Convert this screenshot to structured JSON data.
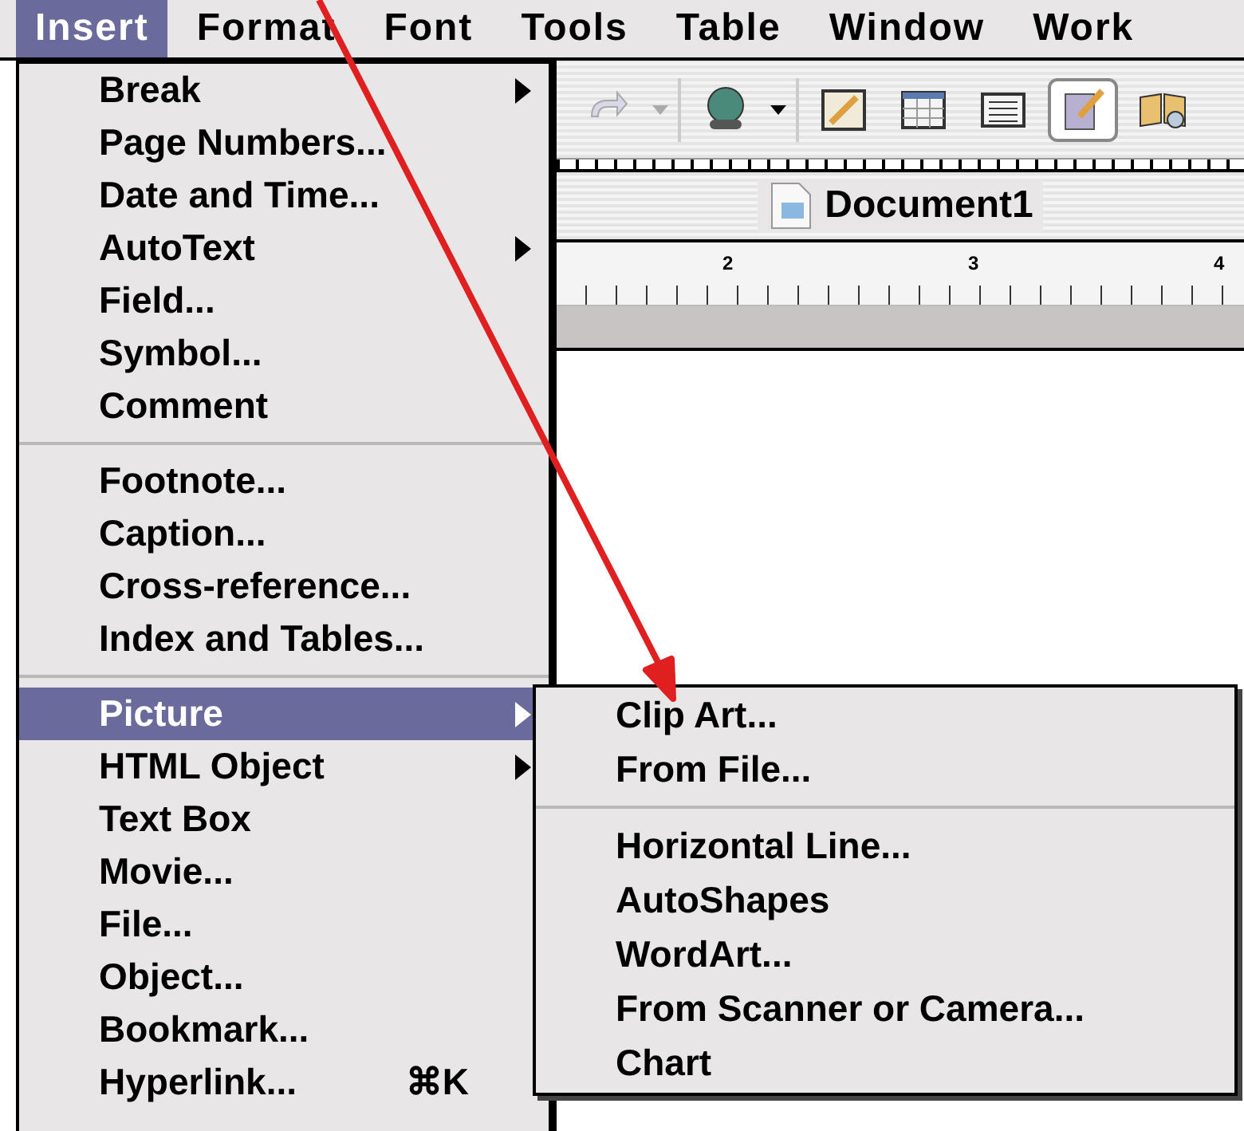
{
  "menu_bar": [
    {
      "label": "Insert",
      "selected": true
    },
    {
      "label": "Format",
      "selected": false
    },
    {
      "label": "Font",
      "selected": false
    },
    {
      "label": "Tools",
      "selected": false
    },
    {
      "label": "Table",
      "selected": false
    },
    {
      "label": "Window",
      "selected": false
    },
    {
      "label": "Work",
      "selected": false
    }
  ],
  "document": {
    "title": "Document1",
    "ruler_marks": [
      "2",
      "3",
      "4"
    ]
  },
  "insert_menu": [
    {
      "kind": "item",
      "label": "Break",
      "submenu": true,
      "selected": false
    },
    {
      "kind": "item",
      "label": "Page Numbers...",
      "submenu": false,
      "selected": false
    },
    {
      "kind": "item",
      "label": "Date and Time...",
      "submenu": false,
      "selected": false
    },
    {
      "kind": "item",
      "label": "AutoText",
      "submenu": true,
      "selected": false
    },
    {
      "kind": "item",
      "label": "Field...",
      "submenu": false,
      "selected": false
    },
    {
      "kind": "item",
      "label": "Symbol...",
      "submenu": false,
      "selected": false
    },
    {
      "kind": "item",
      "label": "Comment",
      "submenu": false,
      "selected": false
    },
    {
      "kind": "separator"
    },
    {
      "kind": "item",
      "label": "Footnote...",
      "submenu": false,
      "selected": false
    },
    {
      "kind": "item",
      "label": "Caption...",
      "submenu": false,
      "selected": false
    },
    {
      "kind": "item",
      "label": "Cross-reference...",
      "submenu": false,
      "selected": false
    },
    {
      "kind": "item",
      "label": "Index and Tables...",
      "submenu": false,
      "selected": false
    },
    {
      "kind": "separator"
    },
    {
      "kind": "item",
      "label": "Picture",
      "submenu": true,
      "selected": true
    },
    {
      "kind": "item",
      "label": "HTML Object",
      "submenu": true,
      "selected": false
    },
    {
      "kind": "item",
      "label": "Text Box",
      "submenu": false,
      "selected": false
    },
    {
      "kind": "item",
      "label": "Movie...",
      "submenu": false,
      "selected": false
    },
    {
      "kind": "item",
      "label": "File...",
      "submenu": false,
      "selected": false
    },
    {
      "kind": "item",
      "label": "Object...",
      "submenu": false,
      "selected": false
    },
    {
      "kind": "item",
      "label": "Bookmark...",
      "submenu": false,
      "selected": false
    },
    {
      "kind": "item",
      "label": "Hyperlink...",
      "shortcut": "⌘K",
      "submenu": false,
      "selected": false
    }
  ],
  "picture_submenu": [
    {
      "kind": "item",
      "label": "Clip Art..."
    },
    {
      "kind": "item",
      "label": "From File..."
    },
    {
      "kind": "separator"
    },
    {
      "kind": "item",
      "label": "Horizontal Line..."
    },
    {
      "kind": "item",
      "label": "AutoShapes"
    },
    {
      "kind": "item",
      "label": "WordArt..."
    },
    {
      "kind": "item",
      "label": "From Scanner or Camera..."
    },
    {
      "kind": "item",
      "label": "Chart"
    }
  ]
}
